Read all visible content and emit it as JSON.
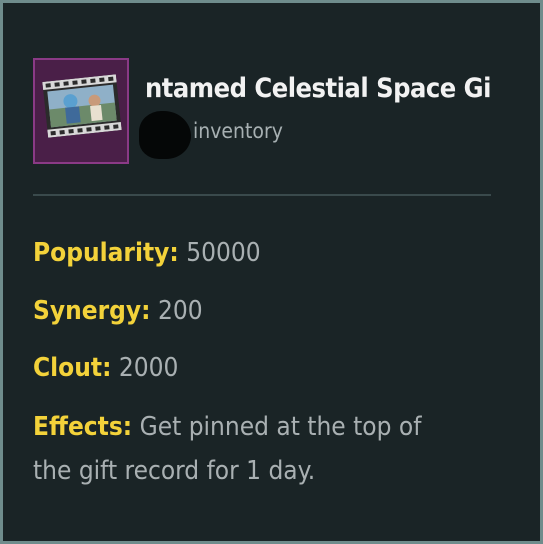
{
  "item": {
    "title": "ntamed Celestial Space Gif",
    "subtitle": "inventory",
    "thumbnail_icon": "film-strip-icon",
    "thumbnail_bg": "#4a1f48"
  },
  "stats": {
    "popularity": {
      "label": "Popularity:",
      "value": "50000"
    },
    "synergy": {
      "label": "Synergy:",
      "value": "200"
    },
    "clout": {
      "label": "Clout:",
      "value": "2000"
    }
  },
  "effects": {
    "label": "Effects:",
    "text": "Get pinned at the top of the gift record for 1 day."
  },
  "colors": {
    "panel_bg": "#1a2426",
    "border": "#6f8c8c",
    "label": "#f3d23a",
    "value": "#a9b0b2",
    "title": "#f2f2f2"
  }
}
